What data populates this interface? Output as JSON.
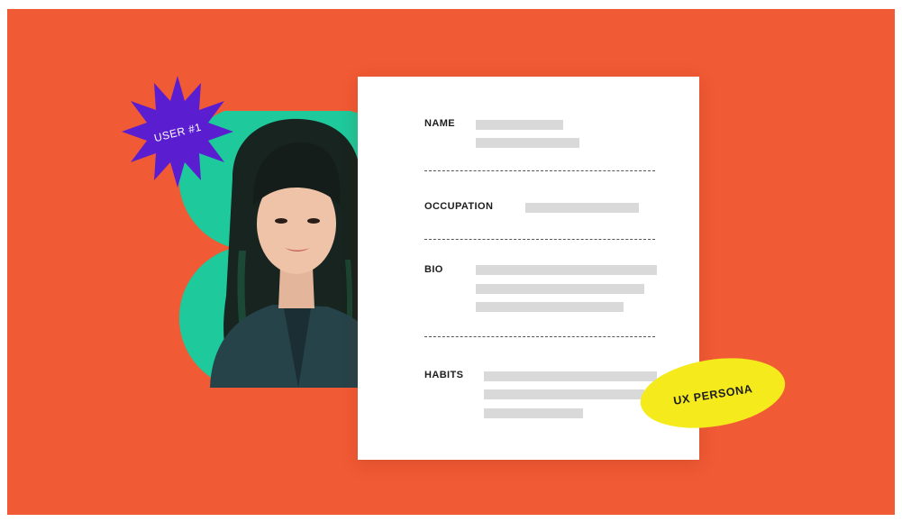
{
  "badge": {
    "text": "USER #1"
  },
  "sticker": {
    "text": "UX PERSONA"
  },
  "profile": {
    "fields": [
      {
        "label": "NAME"
      },
      {
        "label": "OCCUPATION"
      },
      {
        "label": "BIO"
      },
      {
        "label": "HABITS"
      }
    ]
  },
  "colors": {
    "background": "#f05a34",
    "card": "#ffffff",
    "blob": "#1ec99b",
    "starburst": "#5a1ed0",
    "sticker": "#f4ea1c",
    "placeholder": "#d9d9d9"
  },
  "icons": {
    "portrait": "portrait-photo",
    "badge": "starburst-badge",
    "sticker": "oval-sticker"
  }
}
